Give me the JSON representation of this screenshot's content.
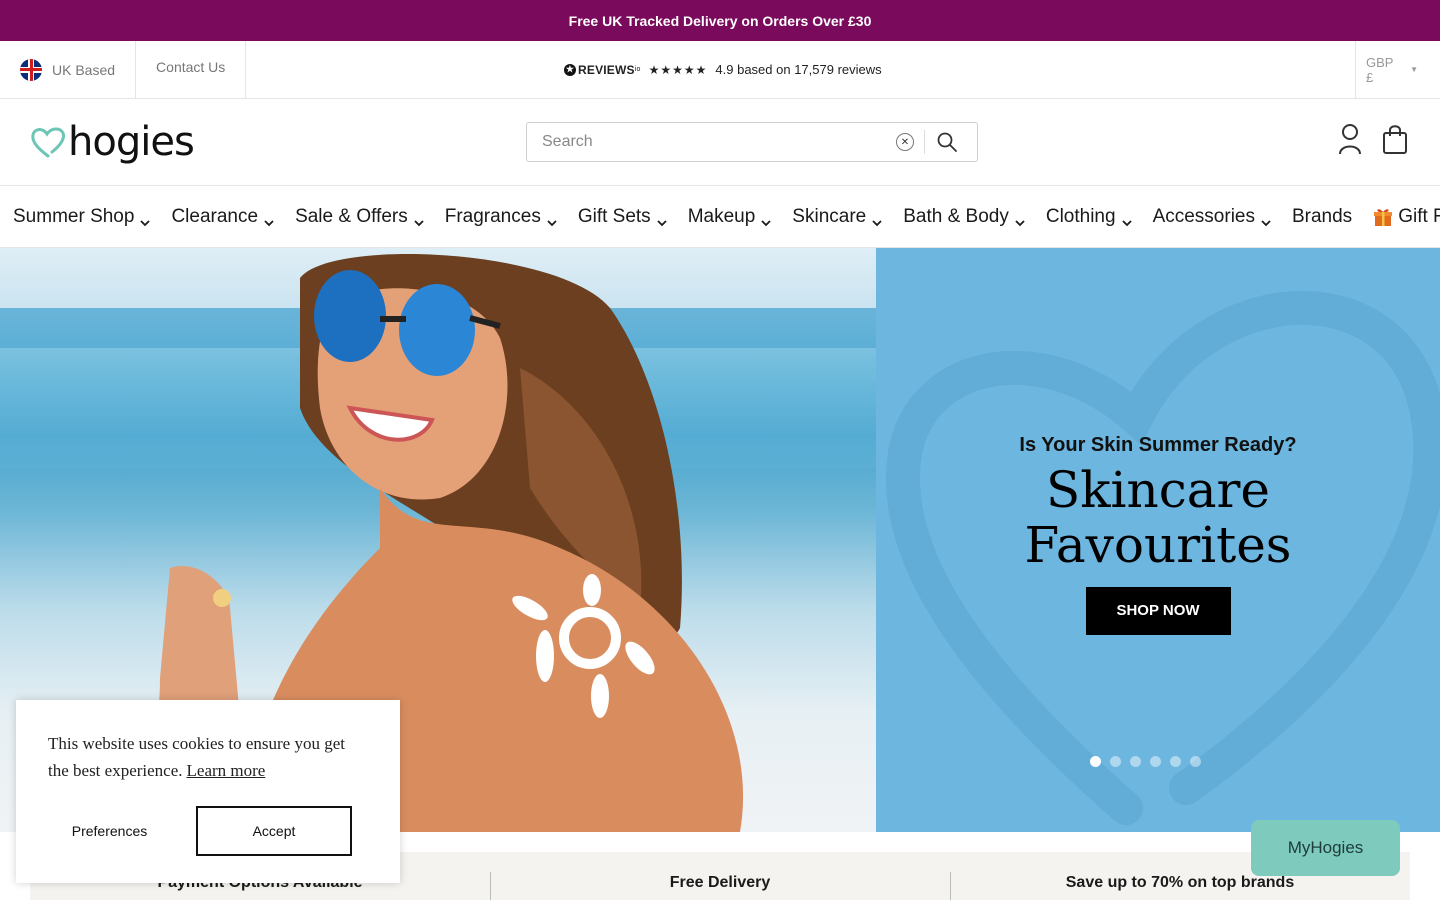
{
  "promo": {
    "text": "Free UK Tracked Delivery on Orders Over £30"
  },
  "utility": {
    "region_label": "UK Based",
    "contact_label": "Contact Us",
    "reviews": {
      "logo": "REVIEWS",
      "logo_suffix": "io",
      "stars": "★★★★★",
      "summary": "4.9 based on 17,579 reviews"
    },
    "currency": "GBP £"
  },
  "header": {
    "logo_text": "hogies",
    "search": {
      "placeholder": "Search",
      "value": ""
    }
  },
  "nav": {
    "items": [
      {
        "label": "Summer Shop",
        "has_dropdown": true
      },
      {
        "label": "Clearance",
        "has_dropdown": true
      },
      {
        "label": "Sale & Offers",
        "has_dropdown": true
      },
      {
        "label": "Fragrances",
        "has_dropdown": true
      },
      {
        "label": "Gift Sets",
        "has_dropdown": true
      },
      {
        "label": "Makeup",
        "has_dropdown": true
      },
      {
        "label": "Skincare",
        "has_dropdown": true
      },
      {
        "label": "Bath & Body",
        "has_dropdown": true
      },
      {
        "label": "Clothing",
        "has_dropdown": true
      },
      {
        "label": "Accessories",
        "has_dropdown": true
      },
      {
        "label": "Brands",
        "has_dropdown": false
      },
      {
        "label": "Gift Finder",
        "has_dropdown": false,
        "icon": "gift-icon"
      }
    ]
  },
  "hero": {
    "subtitle": "Is Your Skin Summer Ready?",
    "title_line1": "Skincare",
    "title_line2": "Favourites",
    "cta": "SHOP NOW",
    "slide_count": 6,
    "active_slide": 1,
    "panel_color": "#6db6e0"
  },
  "cookie": {
    "text": "This website uses cookies to ensure you get the best experience.",
    "learn_more": "Learn more",
    "preferences": "Preferences",
    "accept": "Accept"
  },
  "benefits": [
    {
      "label": "Payment Options Available"
    },
    {
      "label": "Free Delivery"
    },
    {
      "label": "Save up to 70% on top brands"
    }
  ],
  "myhogies": {
    "label": "MyHogies"
  },
  "colors": {
    "brand": "#7a0a5c",
    "accent_teal": "#7ecbbd"
  }
}
